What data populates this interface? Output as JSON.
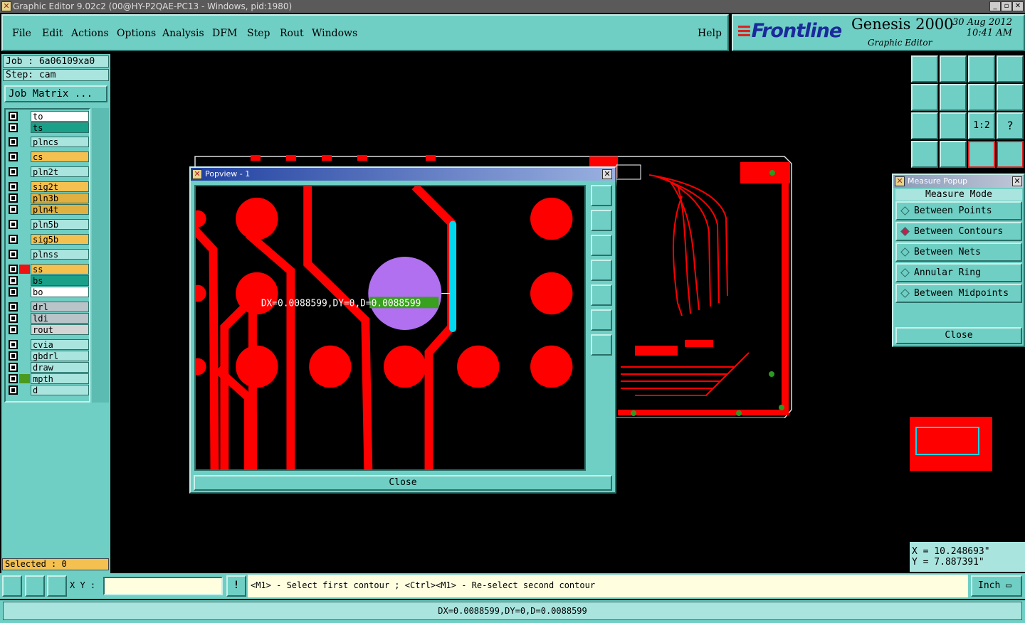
{
  "window": {
    "title": "Graphic Editor 9.02c2 (00@HY-P2QAE-PC13 - Windows, pid:1980)"
  },
  "menu": {
    "items": [
      "File",
      "Edit",
      "Actions",
      "Options",
      "Analysis",
      "DFM",
      "Step",
      "Rout",
      "Windows"
    ],
    "help": "Help"
  },
  "brand": {
    "logo": "Frontline",
    "product": "Genesis 2000",
    "subtitle": "Graphic Editor",
    "date": "30 Aug 2012",
    "time": "10:41 AM"
  },
  "job": {
    "job_label": "Job : 6a06109xa0",
    "step_label": "Step: cam",
    "matrix_button": "Job Matrix ..."
  },
  "layers": [
    {
      "name": "to",
      "color": "#ffffff",
      "swatch": "#6fcfc4"
    },
    {
      "name": "ts",
      "color": "#1aa088",
      "swatch": "#6fcfc4"
    },
    {
      "name": "plncs",
      "color": "#a9e5de",
      "swatch": "#6fcfc4"
    },
    {
      "name": "cs",
      "color": "#f4c050",
      "swatch": "#6fcfc4"
    },
    {
      "name": "pln2t",
      "color": "#a9e5de",
      "swatch": "#6fcfc4"
    },
    {
      "name": "sig2t",
      "color": "#f4c050",
      "swatch": "#6fcfc4"
    },
    {
      "name": "pln3b",
      "color": "#e0b040",
      "swatch": "#6fcfc4"
    },
    {
      "name": "pln4t",
      "color": "#e0b040",
      "swatch": "#6fcfc4"
    },
    {
      "name": "pln5b",
      "color": "#a9e5de",
      "swatch": "#6fcfc4"
    },
    {
      "name": "sig5b",
      "color": "#f4c050",
      "swatch": "#6fcfc4"
    },
    {
      "name": "plnss",
      "color": "#a9e5de",
      "swatch": "#6fcfc4"
    },
    {
      "name": "ss",
      "color": "#f4c050",
      "swatch": "#ee1111"
    },
    {
      "name": "bs",
      "color": "#1aa088",
      "swatch": "#6fcfc4"
    },
    {
      "name": "bo",
      "color": "#ffffff",
      "swatch": "#6fcfc4"
    },
    {
      "name": "drl",
      "color": "#b8c4c8",
      "swatch": "#6fcfc4"
    },
    {
      "name": "ldi",
      "color": "#b8c4c8",
      "swatch": "#6fcfc4"
    },
    {
      "name": "rout",
      "color": "#d4d4d4",
      "swatch": "#6fcfc4"
    },
    {
      "name": "cvia",
      "color": "#a9e5de",
      "swatch": "#6fcfc4"
    },
    {
      "name": "gbdrl",
      "color": "#a9e5de",
      "swatch": "#6fcfc4"
    },
    {
      "name": "draw",
      "color": "#a9e5de",
      "swatch": "#6fcfc4"
    },
    {
      "name": "mpth",
      "color": "#a9e5de",
      "swatch": "#4a9a20"
    },
    {
      "name": "d",
      "color": "#a9e5de",
      "swatch": "#6fcfc4"
    }
  ],
  "selected": "Selected : 0",
  "popview": {
    "title": "Popview - 1",
    "measure_text_a": "DX=0.0088599,DY=0",
    "measure_text_b": ",D=0.0088599",
    "close": "Close"
  },
  "measure_popup": {
    "title": "Measure Popup",
    "header": "Measure Mode",
    "options": [
      "Between Points",
      "Between Contours",
      "Between Nets",
      "Annular Ring",
      "Between Midpoints"
    ],
    "selected_index": 1,
    "close": "Close"
  },
  "coords": {
    "x": "X  = 10.248693\"",
    "y": "Y  = 7.887391\""
  },
  "bottom": {
    "xy_label": "X Y :",
    "xy_value": "",
    "prompt": "<M1> - Select first contour ; <Ctrl><M1> - Re-select second contour",
    "units": "Inch"
  },
  "status": "DX=0.0088599,DY=0,D=0.0088599",
  "colors": {
    "panel": "#6fcfc4",
    "copper": "#ff0000",
    "highlight": "#00d8f0",
    "selected_pad": "#b070f0"
  }
}
